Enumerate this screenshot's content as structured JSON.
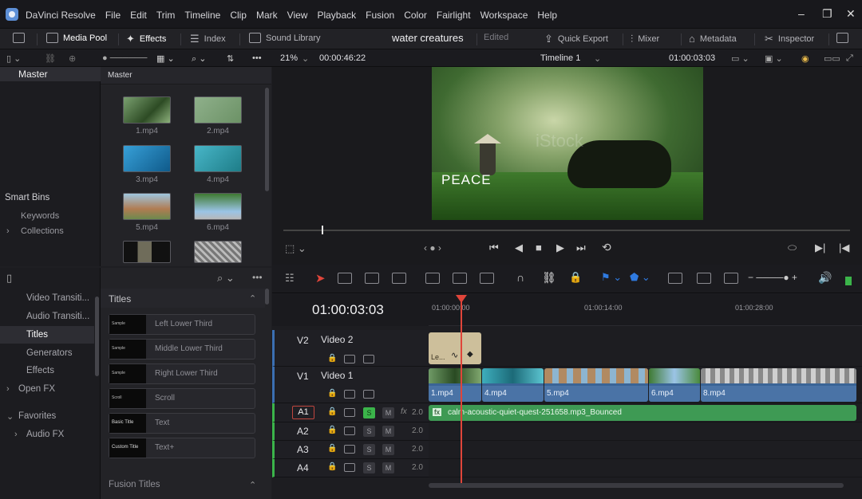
{
  "app": {
    "name": "DaVinci Resolve",
    "menu": [
      "File",
      "Edit",
      "Trim",
      "Timeline",
      "Clip",
      "Mark",
      "View",
      "Playback",
      "Fusion",
      "Color",
      "Fairlight",
      "Workspace",
      "Help"
    ]
  },
  "toolbar": {
    "media_pool": "Media Pool",
    "effects": "Effects",
    "index": "Index",
    "sound_library": "Sound Library",
    "project_name": "water creatures",
    "project_status": "Edited",
    "quick_export": "Quick Export",
    "mixer": "Mixer",
    "metadata": "Metadata",
    "inspector": "Inspector"
  },
  "subbar": {
    "zoom": "21%",
    "source_timecode": "00:00:46:22",
    "timeline_name": "Timeline 1",
    "record_timecode": "01:00:03:03"
  },
  "bins": {
    "master_label": "Master",
    "smart_bins_label": "Smart Bins",
    "keywords": "Keywords",
    "collections": "Collections"
  },
  "media_pool": {
    "header": "Master",
    "clips": [
      {
        "name": "1.mp4"
      },
      {
        "name": "2.mp4"
      },
      {
        "name": "3.mp4"
      },
      {
        "name": "4.mp4"
      },
      {
        "name": "5.mp4"
      },
      {
        "name": "6.mp4"
      }
    ]
  },
  "viewer": {
    "overlay_text": "PEACE",
    "watermark": "iStock"
  },
  "effects": {
    "nav": [
      "Video Transiti...",
      "Audio Transiti...",
      "Titles",
      "Generators",
      "Effects"
    ],
    "open_fx": "Open FX",
    "favorites": "Favorites",
    "audio_fx": "Audio FX",
    "section_title": "Titles",
    "section_fusion": "Fusion Titles",
    "titles": [
      {
        "name": "Left Lower Third",
        "thumb": "Sample"
      },
      {
        "name": "Middle Lower Third",
        "thumb": "Sample"
      },
      {
        "name": "Right Lower Third",
        "thumb": "Sample"
      },
      {
        "name": "Scroll",
        "thumb": "Scroll"
      },
      {
        "name": "Text",
        "thumb": "Basic Title"
      },
      {
        "name": "Text+",
        "thumb": "Custom Title"
      }
    ]
  },
  "timeline": {
    "timecode": "01:00:03:03",
    "ruler": [
      "01:00:00:00",
      "01:00:14:00",
      "01:00:28:00"
    ],
    "tracks": {
      "v2": {
        "id": "V2",
        "name": "Video 2"
      },
      "v1": {
        "id": "V1",
        "name": "Video 1"
      },
      "a1": {
        "id": "A1",
        "level": "2.0",
        "fx": "fx"
      },
      "a2": {
        "id": "A2",
        "level": "2.0"
      },
      "a3": {
        "id": "A3",
        "level": "2.0"
      },
      "a4": {
        "id": "A4",
        "level": "2.0"
      }
    },
    "v2_clip_label": "Le...",
    "v1_clips": [
      "1.mp4",
      "4.mp4",
      "5.mp4",
      "6.mp4",
      "8.mp4"
    ],
    "audio_clip": "calm-acoustic-quiet-quest-251658.mp3_Bounced",
    "solo": "S",
    "mute": "M"
  }
}
